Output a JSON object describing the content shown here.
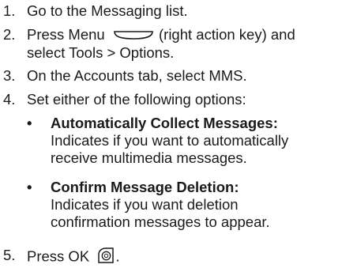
{
  "steps": [
    {
      "num": "1.",
      "text": "Go to the Messaging list."
    },
    {
      "num": "2.",
      "text_a": "Press Menu",
      "text_b": "(right action key) and",
      "text_c": "select Tools > Options."
    },
    {
      "num": "3.",
      "text": "On the Accounts tab, select MMS."
    },
    {
      "num": "4.",
      "text": "Set either of the following options:"
    },
    {
      "num": "5.",
      "text_a": "Press OK",
      "text_b": "."
    }
  ],
  "options": [
    {
      "bullet": "•",
      "title": "Automatically Collect Messages:",
      "line1": "Indicates if you want to automatically",
      "line2": "receive multimedia messages."
    },
    {
      "bullet": "•",
      "title": "Confirm Message Deletion:",
      "line1": "Indicates if you want deletion",
      "line2": "confirmation messages to appear."
    }
  ],
  "icons": {
    "menu_key": "right-action-key-icon",
    "ok_key": "ok-key-icon"
  }
}
